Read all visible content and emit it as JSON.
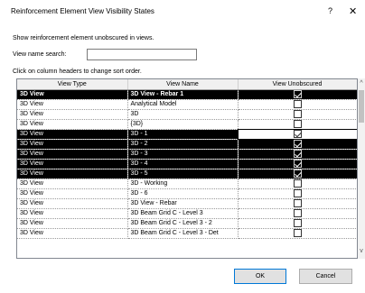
{
  "dialog": {
    "title": "Reinforcement Element View Visibility States",
    "help_glyph": "?",
    "close_glyph": "✕",
    "description": "Show reinforcement element unobscured in views.",
    "search_label": "View name search:",
    "search_value": "",
    "sort_hint": "Click on column headers to change sort order."
  },
  "table": {
    "columns": [
      "View Type",
      "View Name",
      "View Unobscured"
    ],
    "rows": [
      {
        "type": "3D View",
        "name": "3D View - Rebar 1",
        "checked": true,
        "selected": true,
        "bold": true
      },
      {
        "type": "3D View",
        "name": "Analytical Model",
        "checked": false,
        "selected": false
      },
      {
        "type": "3D View",
        "name": "3D",
        "checked": false,
        "selected": false
      },
      {
        "type": "3D View",
        "name": "{3D}",
        "checked": false,
        "selected": false
      },
      {
        "type": "3D View",
        "name": "3D - 1",
        "checked": true,
        "selected": true,
        "active": true
      },
      {
        "type": "3D View",
        "name": "3D - 2",
        "checked": true,
        "selected": true
      },
      {
        "type": "3D View",
        "name": "3D - 3",
        "checked": true,
        "selected": true
      },
      {
        "type": "3D View",
        "name": "3D - 4",
        "checked": true,
        "selected": true
      },
      {
        "type": "3D View",
        "name": "3D - 5",
        "checked": true,
        "selected": true
      },
      {
        "type": "3D View",
        "name": "3D - Working",
        "checked": false,
        "selected": false
      },
      {
        "type": "3D View",
        "name": "3D - 6",
        "checked": false,
        "selected": false
      },
      {
        "type": "3D View",
        "name": "3D View - Rebar",
        "checked": false,
        "selected": false
      },
      {
        "type": "3D View",
        "name": "3D Beam Grid C - Level 3",
        "checked": false,
        "selected": false
      },
      {
        "type": "3D View",
        "name": "3D Beam Grid C - Level 3 - 2",
        "checked": false,
        "selected": false
      },
      {
        "type": "3D View",
        "name": "3D Beam Grid C - Level 3 - Det",
        "checked": false,
        "selected": false
      }
    ]
  },
  "scrollbar": {
    "up_glyph": "^",
    "down_glyph": "v"
  },
  "buttons": {
    "ok": "OK",
    "cancel": "Cancel"
  }
}
